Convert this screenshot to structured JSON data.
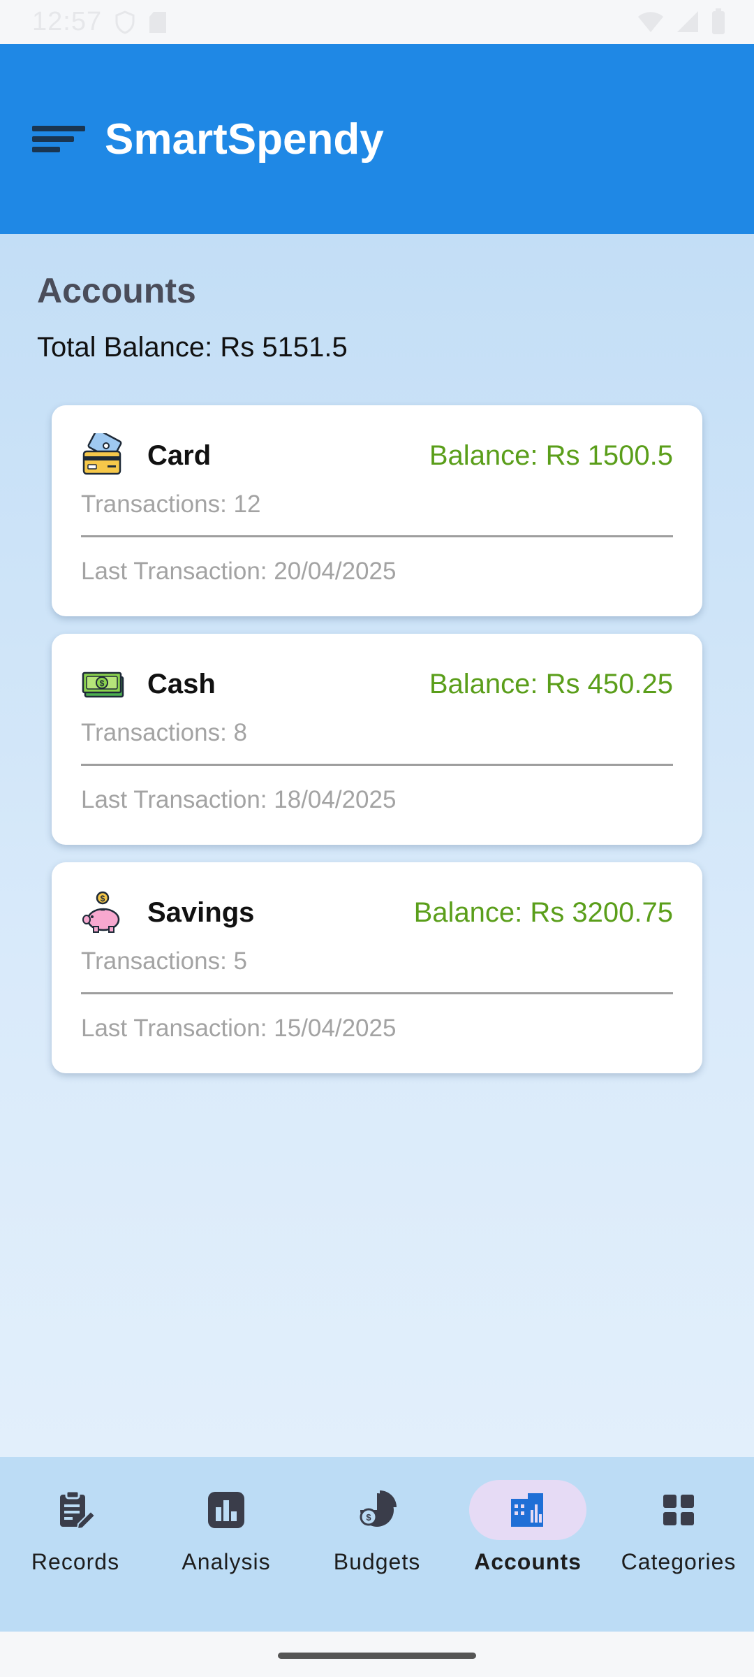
{
  "status_bar": {
    "time": "12:57"
  },
  "app_bar": {
    "title": "SmartSpendy",
    "menu_icon": "sort-menu-icon"
  },
  "accounts": {
    "title": "Accounts",
    "total_balance": "Total Balance: Rs 5151.5",
    "items": [
      {
        "icon": "credit-card-icon",
        "name": "Card",
        "balance": "Balance: Rs 1500.5",
        "transactions": "Transactions: 12",
        "last_transaction": "Last Transaction: 20/04/2025"
      },
      {
        "icon": "cash-icon",
        "name": "Cash",
        "balance": "Balance: Rs 450.25",
        "transactions": "Transactions: 8",
        "last_transaction": "Last Transaction: 18/04/2025"
      },
      {
        "icon": "piggy-bank-icon",
        "name": "Savings",
        "balance": "Balance: Rs 3200.75",
        "transactions": "Transactions: 5",
        "last_transaction": "Last Transaction: 15/04/2025"
      }
    ]
  },
  "bottom_nav": {
    "items": [
      {
        "label": "Records",
        "icon": "clipboard-edit-icon",
        "active": false
      },
      {
        "label": "Analysis",
        "icon": "bar-chart-icon",
        "active": false
      },
      {
        "label": "Budgets",
        "icon": "pie-chart-money-icon",
        "active": false
      },
      {
        "label": "Accounts",
        "icon": "accounts-building-icon",
        "active": true
      },
      {
        "label": "Categories",
        "icon": "grid-icon",
        "active": false
      }
    ]
  },
  "colors": {
    "app_bar": "#1f88e5",
    "balance_text": "#5a9e1a",
    "active_nav_pill": "#e6dbf5",
    "nav_background": "#bcdcf5"
  }
}
